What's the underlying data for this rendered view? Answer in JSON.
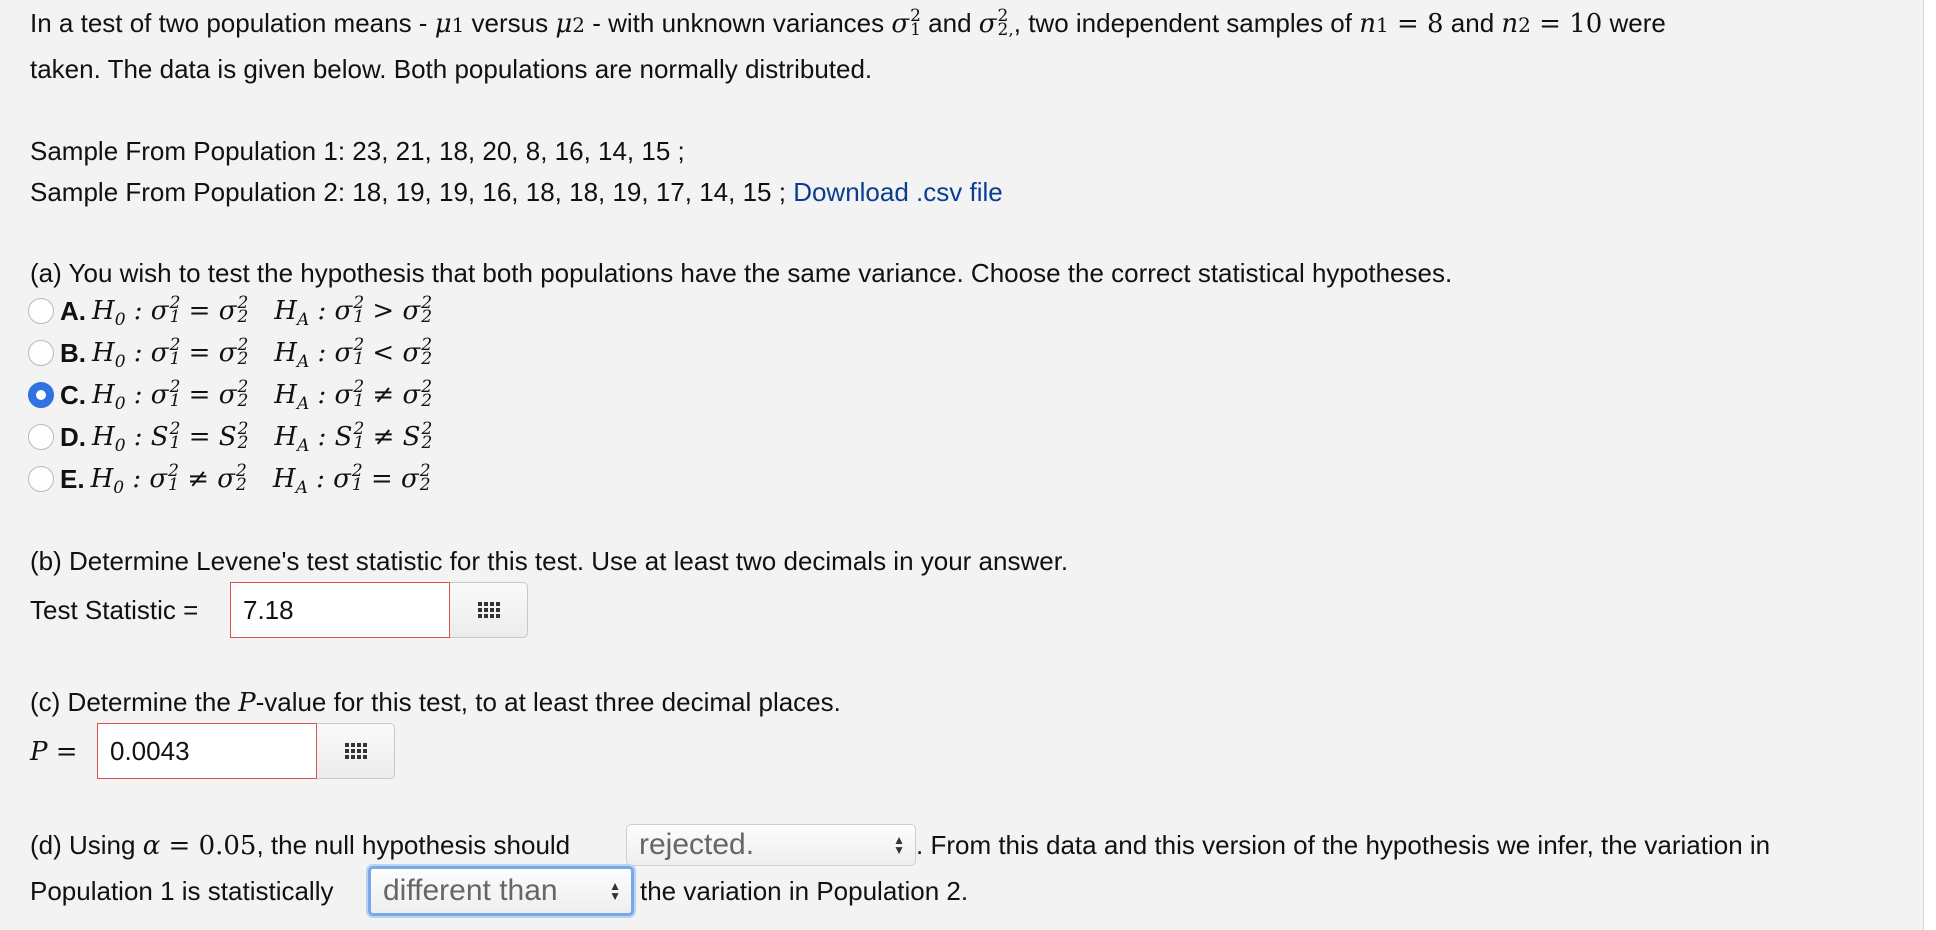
{
  "intro": {
    "line1_a": "In a test of two population means - ",
    "mu1": "μ1",
    "versus": " versus ",
    "mu2": "μ2",
    "line1_b": " - with unknown variances ",
    "and1": " and ",
    "line1_c": ", two independent samples of ",
    "n1": "n1 = 8",
    "and2": " and ",
    "n2": "n2 = 10",
    "line1_d": " were",
    "line2": "taken. The data is given below. Both populations are normally distributed."
  },
  "samples": {
    "pop1": "Sample From Population 1: 23, 21, 18, 20, 8, 16, 14, 15 ;",
    "pop2": "Sample From Population 2: 18, 19, 19, 16, 18, 18, 19, 17, 14, 15 ;",
    "download_link": "Download .csv file"
  },
  "part_a": {
    "prompt": "(a) You wish to test the hypothesis that both populations have the same variance. Choose the correct statistical hypotheses.",
    "options": [
      {
        "letter": "A.",
        "h0": "H0 : σ²₁ = σ²₂",
        "ha": "HA : σ²₁ > σ²₂",
        "selected": false
      },
      {
        "letter": "B.",
        "h0": "H0 : σ²₁ = σ²₂",
        "ha": "HA : σ²₁ < σ²₂",
        "selected": false
      },
      {
        "letter": "C.",
        "h0": "H0 : σ²₁ = σ²₂",
        "ha": "HA : σ²₁ ≠ σ²₂",
        "selected": true
      },
      {
        "letter": "D.",
        "h0": "H0 : S²₁ = S²₂",
        "ha": "HA : S²₁ ≠ S²₂",
        "selected": false
      },
      {
        "letter": "E.",
        "h0": "H0 : σ²₁ ≠ σ²₂",
        "ha": "HA : σ²₁ = σ²₂",
        "selected": false
      }
    ]
  },
  "part_b": {
    "prompt": "(b) Determine Levene's test statistic for this test. Use at least two decimals in your answer.",
    "label": "Test Statistic =",
    "value": "7.18"
  },
  "part_c": {
    "prompt_a": "(c) Determine the ",
    "prompt_p": "P",
    "prompt_b": "-value for this test, to at least three decimal places.",
    "label": "P =",
    "value": "0.0043"
  },
  "part_d": {
    "text_a": "(d) Using ",
    "alpha": "α = 0.05",
    "text_b": ", the null hypothesis should",
    "select1": "rejected.",
    "text_c": ". From this data and this version of the hypothesis we infer, the variation in",
    "text_d": "Population 1 is statistically",
    "select2": "different than",
    "text_e": "the variation in Population 2."
  },
  "colors": {
    "link": "#0a3d91",
    "radio_selected": "#2f72e0",
    "input_border": "#d9534f",
    "focus_ring": "#7aa7e8"
  }
}
